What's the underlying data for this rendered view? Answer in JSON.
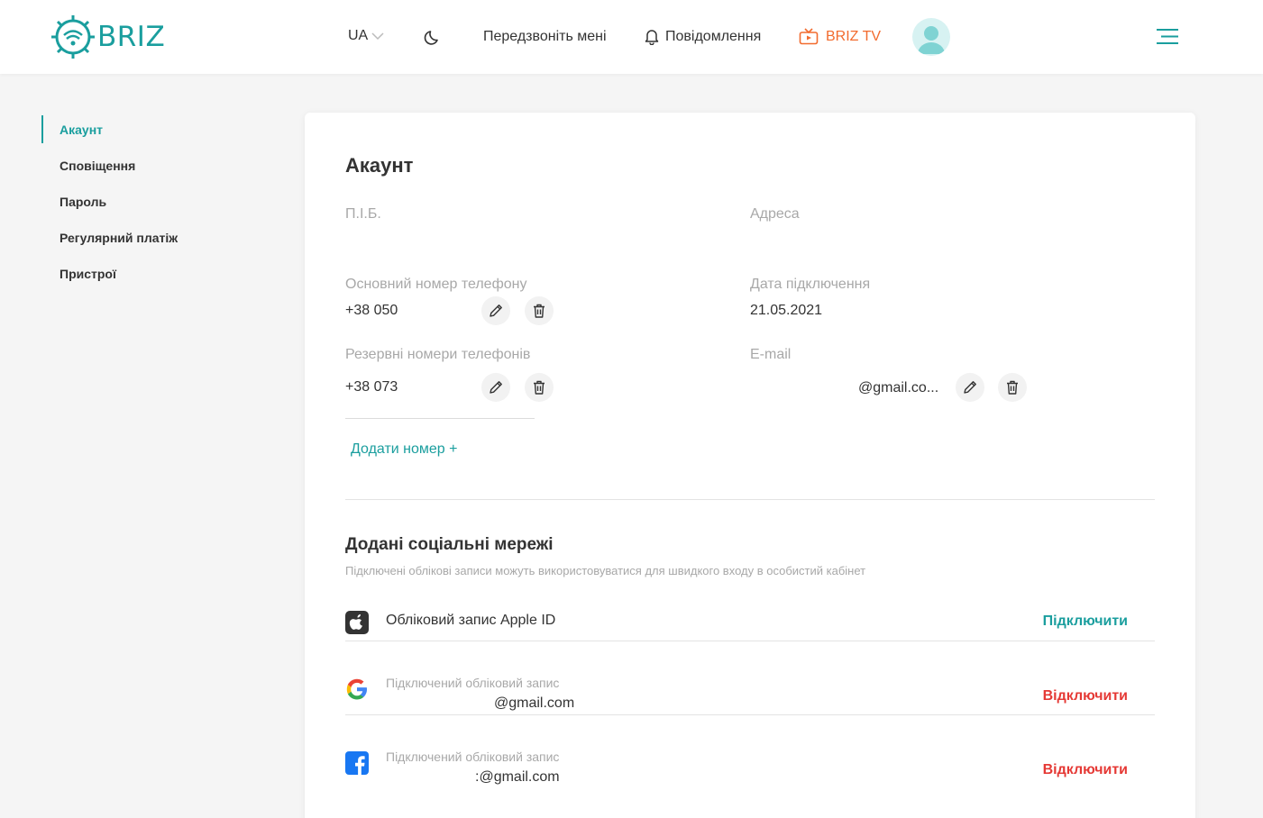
{
  "header": {
    "logo_text": "BRIZ",
    "lang": "UA",
    "callback": "Передзвоніть мені",
    "notifications": "Повідомлення",
    "tv": "BRIZ TV"
  },
  "colors": {
    "brand": "#1a9e9e",
    "tv": "#f26b2e",
    "danger": "#e53935"
  },
  "sidebar": {
    "items": [
      {
        "label": "Акаунт",
        "active": true
      },
      {
        "label": "Сповіщення"
      },
      {
        "label": "Пароль"
      },
      {
        "label": "Регулярний платіж"
      },
      {
        "label": "Пристрої"
      }
    ]
  },
  "account": {
    "title": "Акаунт",
    "name_label": "П.І.Б.",
    "address_label": "Адреса",
    "main_phone_label": "Основний номер телефону",
    "main_phone": "+38 050",
    "connection_date_label": "Дата підключення",
    "connection_date": "21.05.2021",
    "backup_phones_label": "Резервні номери телефонів",
    "backup_phone": "+38 073",
    "email_label": "E-mail",
    "email": "@gmail.co...",
    "add_number": "Додати номер +"
  },
  "social": {
    "title": "Додані соціальні мережі",
    "subtitle": "Підключені облікові записи можуть використовуватися для швидкого входу в особистий кабінет",
    "apple": {
      "label": "Обліковий запис Apple ID",
      "action": "Підключити",
      "icon": "apple-icon"
    },
    "google": {
      "caption": "Підключений обліковий запис",
      "email": "@gmail.com",
      "action": "Відключити",
      "icon": "google-icon"
    },
    "facebook": {
      "caption": "Підключений обліковий запис",
      "email": ":@gmail.com",
      "action": "Відключити",
      "icon": "facebook-icon"
    }
  }
}
